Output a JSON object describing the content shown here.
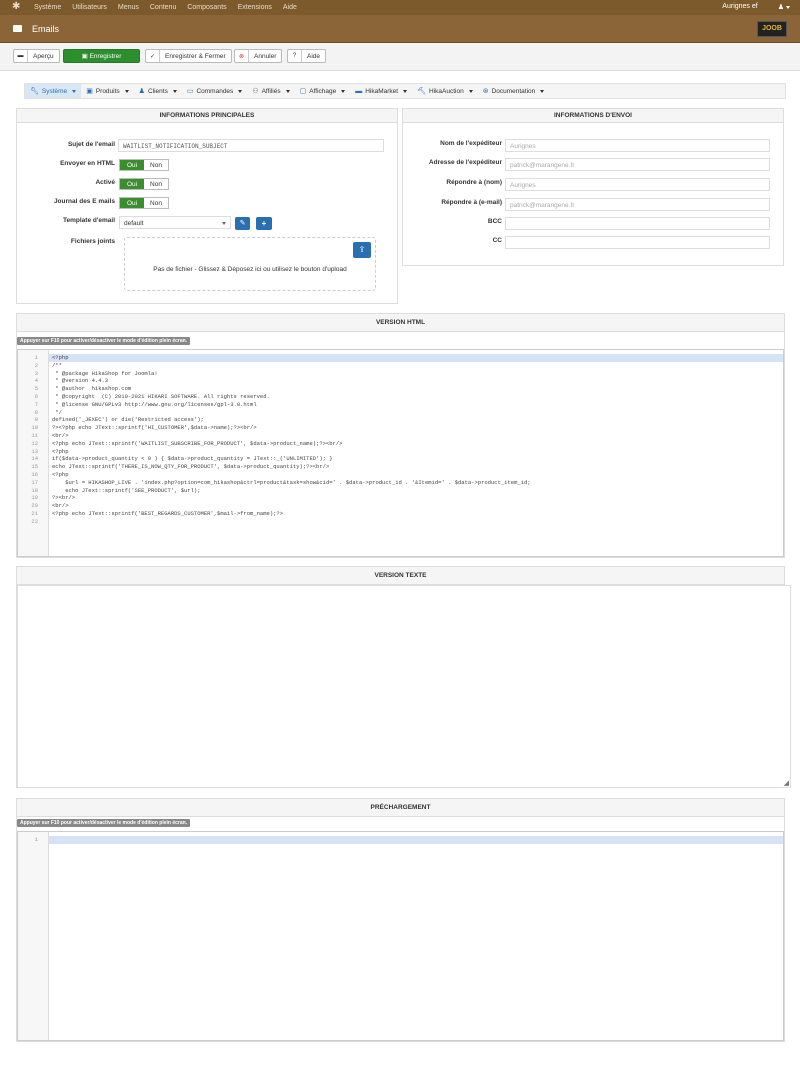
{
  "topbar": {
    "menus": [
      "Système",
      "Utilisateurs",
      "Menus",
      "Contenu",
      "Composants",
      "Extensions",
      "Aide"
    ],
    "user": "Aurignes ef",
    "user_icon": "user-icon"
  },
  "header": {
    "title": "Emails",
    "logo_text": "JOOB"
  },
  "toolbar": {
    "preview": "Aperçu",
    "save": "Enregistrer",
    "save_close": "Enregistrer & Fermer",
    "cancel": "Annuler",
    "help": "Aide"
  },
  "nav": {
    "items": [
      "Système",
      "Produits",
      "Clients",
      "Commandes",
      "Affiliés",
      "Affichage",
      "HikaMarket",
      "HikaAuction",
      "Documentation"
    ]
  },
  "main_info": {
    "title": "INFORMATIONS PRINCIPALES",
    "subject_label": "Sujet de l'email",
    "subject_value": "WAITLIST_NOTIFICATION_SUBJECT",
    "html_label": "Envoyer en HTML",
    "active_label": "Activé",
    "journal_label": "Journal des E mails",
    "template_label": "Template d'email",
    "template_value": "default",
    "attachments_label": "Fichiers joints",
    "dropzone_text": "Pas de fichier - Glissez & Déposez ici ou utilisez le bouton d'upload",
    "yes": "Oui",
    "no": "Non"
  },
  "send_info": {
    "title": "INFORMATIONS D'ENVOI",
    "from_name_label": "Nom de l'expéditeur",
    "from_name_ph": "Aurignes",
    "from_email_label": "Adresse de l'expéditeur",
    "from_email_ph": "patrick@marangene.fr",
    "reply_name_label": "Répondre à (nom)",
    "reply_name_ph": "Aurignes",
    "reply_email_label": "Répondre à (e-mail)",
    "reply_email_ph": "patrick@marangene.fr",
    "bcc_label": "BCC",
    "cc_label": "CC"
  },
  "html_version": {
    "title": "VERSION HTML",
    "hint": "Appuyer sur F10 pour activer/désactiver le mode d'édition plein écran.",
    "lines": [
      "<?php",
      "/**",
      " * @package HikaShop for Joomla!",
      " * @version 4.4.3",
      " * @author  hikashop.com",
      " * @copyright  (C) 2010-2021 HIKARI SOFTWARE. All rights reserved.",
      " * @license GNU/GPLv3 http://www.gnu.org/licenses/gpl-3.0.html",
      " */",
      "defined('_JEXEC') or die('Restricted access');",
      "?><?php echo JText::sprintf('HI_CUSTOMER',$data->name);?><br/>",
      "<br/>",
      "<?php echo JText::sprintf('WAITLIST_SUBSCRIBE_FOR_PRODUCT', $data->product_name);?><br/>",
      "<?php",
      "if($data->product_quantity < 0 ) { $data->product_quantity = JText::_('UNLIMITED'); }",
      "echo JText::sprintf('THERE_IS_NOW_QTY_FOR_PRODUCT', $data->product_quantity);?><br/>",
      "<?php",
      "    $url = HIKASHOP_LIVE . 'index.php?option=com_hikashop&ctrl=product&task=show&cid=' . $data->product_id . '&Itemid=' . $data->product_item_id;",
      "    echo JText::sprintf('SEE_PRODUCT', $url);",
      "?><br/>",
      "<br/>",
      "<?php echo JText::sprintf('BEST_REGARDS_CUSTOMER',$mail->from_name);?>",
      ""
    ]
  },
  "text_version": {
    "title": "VERSION TEXTE"
  },
  "preload": {
    "title": "PRÉCHARGEMENT",
    "hint": "Appuyer sur F10 pour activer/désactiver le mode d'édition plein écran.",
    "lines": [
      ""
    ]
  }
}
